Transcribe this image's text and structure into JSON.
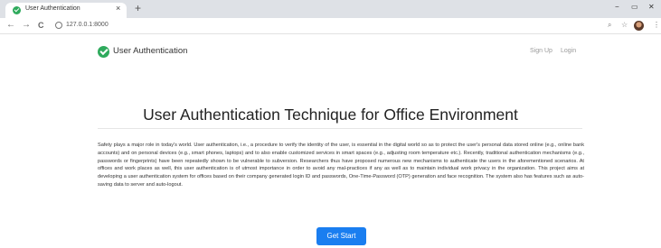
{
  "browser": {
    "tab_title": "User Authentication",
    "tab_close": "×",
    "new_tab": "+",
    "window": {
      "minimize": "−",
      "restore": "▭",
      "close": "✕"
    },
    "nav": {
      "back": "←",
      "forward": "→",
      "reload": "C"
    },
    "url": "127.0.0.1:8000",
    "icons": [
      "search-icon",
      "star-icon",
      "profile-avatar",
      "menu-icon"
    ]
  },
  "navbar": {
    "brand": "User Authentication",
    "sign_up": "Sign Up",
    "login": "Login"
  },
  "main": {
    "title": "User Authentication Technique for Office Environment",
    "description": "Safety plays a major role in today's world. User authentication, i.e., a procedure to verify the identity of the user, is essential in the digital world so as to protect the user's personal data stored online (e.g., online bank accounts) and on personal devices (e.g., smart phones, laptops) and to also enable customized services in smart spaces (e.g., adjusting room temperature etc.). Recently, traditional authentication mechanisms (e.g., passwords or fingerprints) have been repeatedly shown to be vulnerable to subversion. Researchers thus have proposed numerous new mechanisms to authenticate the users in the aforementioned scenarios. At offices and work places as well, this user authentication is of utmost importance in order to avoid any mal-practices if any as well as to maintain individual work privacy in the organization. This project aims at developing a user authentication system for offices based on their company generated login ID and passwords, One-Time-Password (OTP) generation and face recognition. The system also has features such as auto-saving data to server and auto-logout.",
    "cta": "Get Start"
  },
  "colors": {
    "accent": "#1a7ef0",
    "brand_check": "#2eaa5c",
    "nav_link": "#9a9a9a"
  }
}
